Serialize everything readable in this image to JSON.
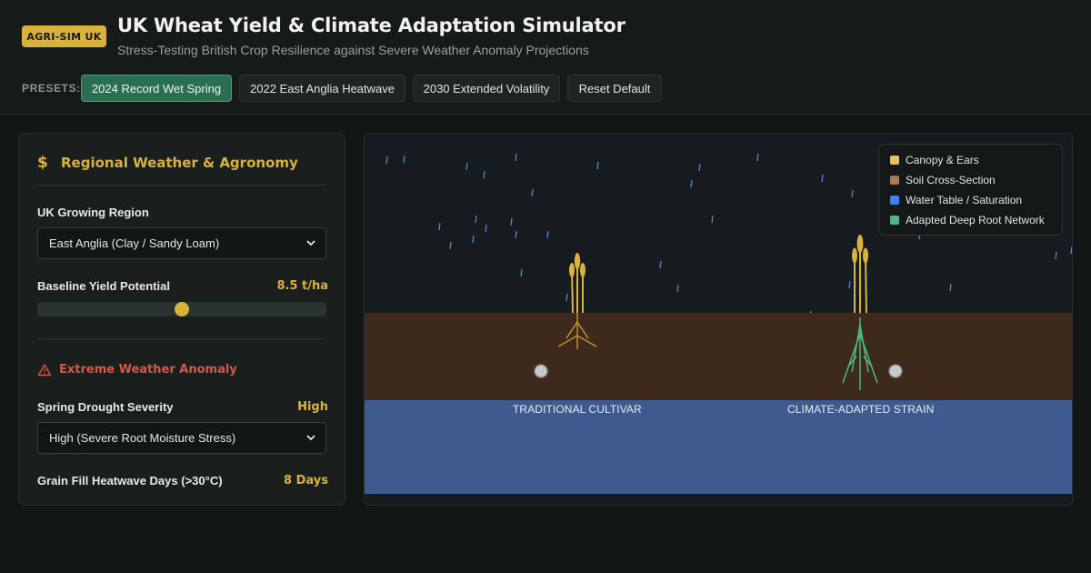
{
  "header": {
    "badge": "AGRI-SIM UK",
    "title": "UK Wheat Yield & Climate Adaptation Simulator",
    "subtitle": "Stress-Testing British Crop Resilience against Severe Weather Anomaly Projections",
    "presets_label": "PRESETS:",
    "presets": [
      {
        "label": "2024 Record Wet Spring",
        "active": true
      },
      {
        "label": "2022 East Anglia Heatwave",
        "active": false
      },
      {
        "label": "2030 Extended Volatility",
        "active": false
      },
      {
        "label": "Reset Default",
        "active": false
      }
    ]
  },
  "panel": {
    "icon": "dollar-icon",
    "icon_glyph": "$",
    "title": "Regional Weather & Agronomy",
    "region": {
      "label": "UK Growing Region",
      "value": "East Anglia (Clay / Sandy Loam)"
    },
    "baseline": {
      "label": "Baseline Yield Potential",
      "value": "8.5 t/ha",
      "slider_fraction": 0.5
    },
    "anomaly": {
      "icon": "warning-triangle-icon",
      "title": "Extreme Weather Anomaly"
    },
    "drought": {
      "label": "Spring Drought Severity",
      "value": "High",
      "select_value": "High (Severe Root Moisture Stress)"
    },
    "heatwave": {
      "label": "Grain Fill Heatwave Days (>30°C)",
      "value": "8 Days"
    }
  },
  "simulation": {
    "legend": [
      {
        "label": "Canopy & Ears",
        "color": "#e8c157"
      },
      {
        "label": "Soil Cross-Section",
        "color": "#a57c52"
      },
      {
        "label": "Water Table / Saturation",
        "color": "#3b82f6"
      },
      {
        "label": "Adapted Deep Root Network",
        "color": "#4fb888"
      }
    ],
    "cultivars": [
      {
        "label": "TRADITIONAL CULTIVAR"
      },
      {
        "label": "CLIMATE-ADAPTED STRAIN"
      }
    ],
    "colors": {
      "sky": "#161b20",
      "soil": "#3d2a1c",
      "water": "#3e5a8f",
      "rain": "#5a87c7",
      "wheat": "#dcb23e",
      "trad_root": "#c48d35",
      "adapted_root": "#4fb888",
      "probe": "#c8c8c8"
    }
  }
}
